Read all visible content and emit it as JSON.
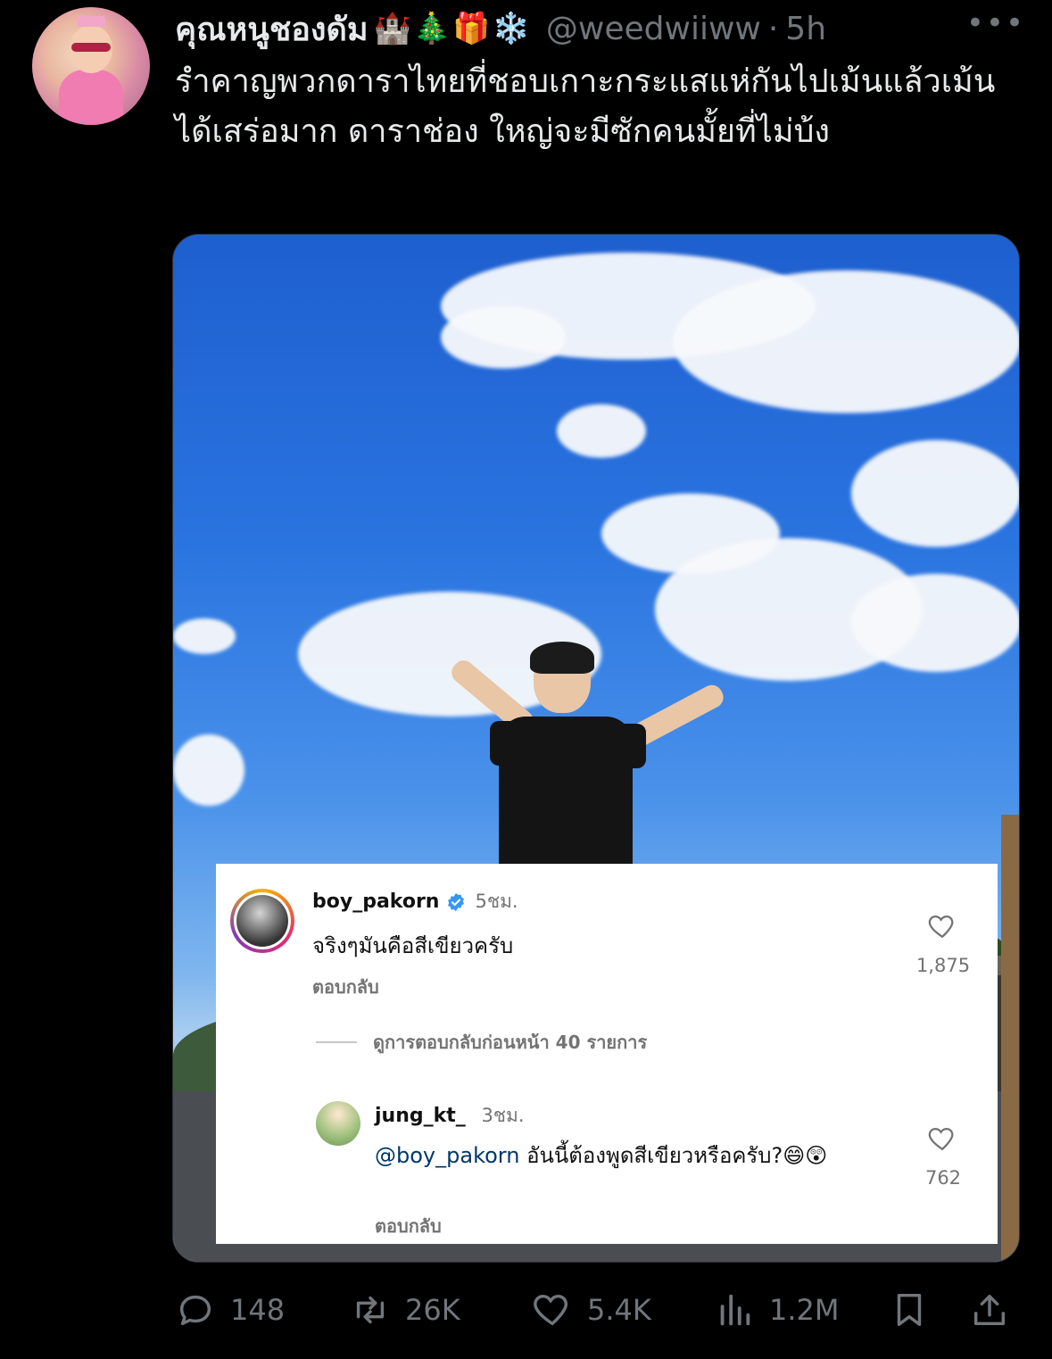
{
  "tweet": {
    "display_name": "คุณหนูชองดัม",
    "emojis": "🏰🎄🎁❄️",
    "handle": "@weedwiiww",
    "separator": "·",
    "time": "5h",
    "more": "•••",
    "text": "รำคาญพวกดาราไทยที่ชอบเกาะกระแสแห่กันไปเม้นแล้วเม้นได้เสร่อมาก ดาราช่อง ใหญ่จะมีซักคนมั้ยที่ไม่บ้ง"
  },
  "ig": {
    "comment1": {
      "username": "boy_pakorn",
      "time": "5ชม.",
      "text": "จริงๆมันคือสีเขียวครับ",
      "reply": "ตอบกลับ",
      "likes": "1,875"
    },
    "view_previous": "ดูการตอบกลับก่อนหน้า 40 รายการ",
    "comment2": {
      "username": "jung_kt_",
      "time": "3ชม.",
      "mention": "@boy_pakorn",
      "text": " อันนี้ต้องพูดสีเขียวหรือครับ?😄😲",
      "reply": "ตอบกลับ",
      "likes": "762"
    }
  },
  "actions": {
    "replies": "148",
    "retweets": "26K",
    "likes": "5.4K",
    "views": "1.2M"
  }
}
